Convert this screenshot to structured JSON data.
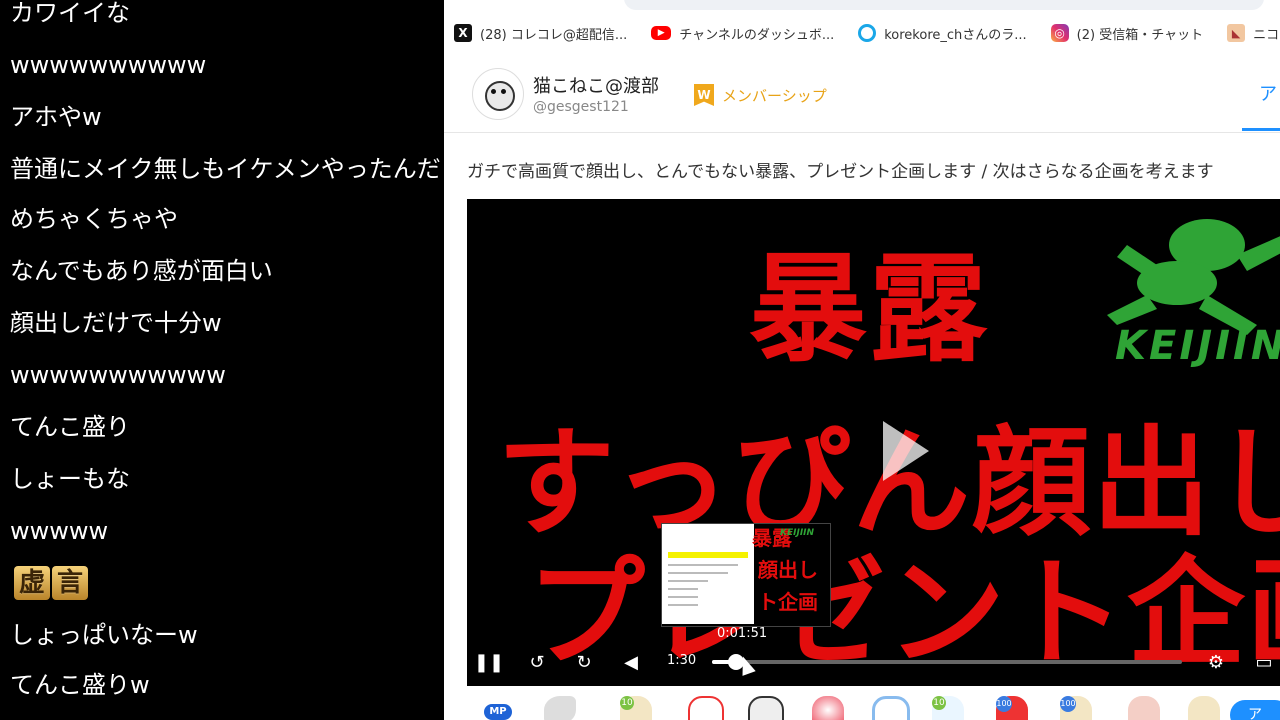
{
  "comments": [
    "カワイイな",
    "wwwwwwwwww",
    "アホやw",
    "普通にメイク無しもイケメンやったんだ",
    "めちゃくちゃや",
    "なんでもあり感が面白い",
    "顔出しだけで十分w",
    "wwwwwwwwwww",
    "てんこ盛り",
    "しょーもな",
    "wwwww",
    "しょっぱいなーw",
    "てんこ盛りw"
  ],
  "kyogen_chars": [
    "虚",
    "言"
  ],
  "bookmarks": {
    "x": "(28) コレコレ@超配信...",
    "youtube": "チャンネルのダッシュボ...",
    "kore": "korekore_chさんのラ...",
    "instagram": "(2) 受信箱・チャット",
    "nico": "ニコニコ生放送 |リ"
  },
  "profile": {
    "name": "猫こねこ@渡部",
    "handle": "@gesgest121",
    "membership": "メンバーシップ",
    "tab_partial": "ア"
  },
  "video_title": "ガチで高画質で顔出し、とんでもない暴露、プレゼント企画します / 次はさらなる企画を考えます",
  "video_text": {
    "line1": "暴露",
    "line2": "すっぴん顔出し",
    "line3": "プレゼント企画",
    "logo_text": "KEIJIIN",
    "preview_line1": "暴露",
    "preview_line2": "顔出し",
    "preview_line3": "ト企画",
    "preview_logo": "KEIJIIN"
  },
  "player": {
    "hover_time": "0:01:51",
    "current_time": "1:30",
    "progress_fraction": 0.05,
    "icons": [
      "pause-icon",
      "rewind-10-icon",
      "forward-10-icon",
      "volume-icon",
      "settings-icon",
      "theater-mode-icon"
    ]
  },
  "gifts": {
    "mp_label": "MP",
    "badge_10": "10",
    "badge_100": "100",
    "right_button": "ア"
  },
  "colors": {
    "video_red": "#e30d0d",
    "logo_green": "#2fa436",
    "accent_blue": "#1e90ff",
    "membership_orange": "#e8a317"
  }
}
